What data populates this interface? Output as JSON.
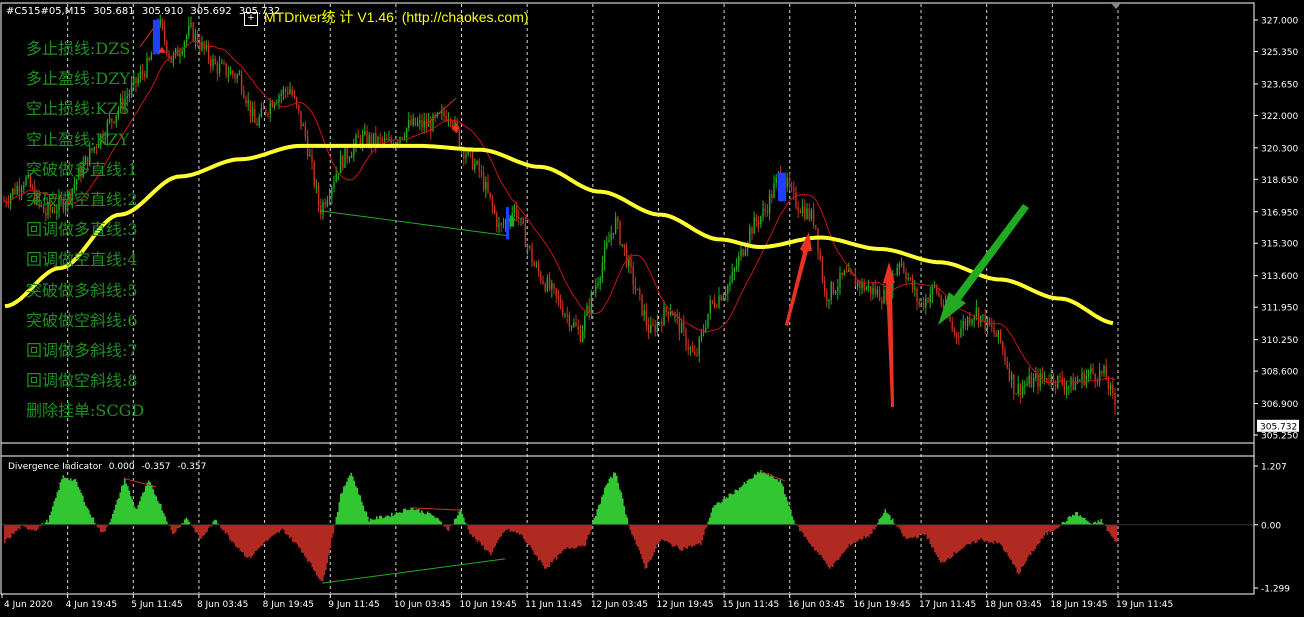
{
  "header": {
    "symbol_tf": "#C515#05,M15",
    "ohlc": [
      "305.681",
      "305.910",
      "305.692",
      "305.732"
    ]
  },
  "brand": {
    "title": "MTDriver统 计 V1.46",
    "url": "(http://chaokes.com)"
  },
  "commands": [
    "多止损线:DZS",
    "多止盈线:DZY",
    "空止损线:KZS",
    "空止盈线:KZY",
    "突破做多直线:1",
    "突破做空直线:2",
    "回调做多直线:3",
    "回调做空直线:4",
    "突破做多斜线:5",
    "突破做空斜线:6",
    "回调做多斜线:7",
    "回调做空斜线:8",
    "删除挂单:SCGD"
  ],
  "indicator": {
    "name": "Divergence Indicator",
    "values": [
      "0.000",
      "-0.357",
      "-0.357"
    ]
  },
  "colors": {
    "background": "#000000",
    "bull_candle": "#22b022",
    "bear_candle": "#c8321e",
    "ma_slow": "#ffff33",
    "ma_fast": "#c81414",
    "hist_pos": "#33c633",
    "hist_neg": "#b02a22",
    "arrow_red": "#e83222",
    "arrow_green": "#22aa22",
    "grid": "#ffffff",
    "price_tag_bg": "#ffffff"
  },
  "chart_data": [
    {
      "type": "line",
      "series": [],
      "ylim": [
        305.25,
        327.0
      ],
      "price_ticks": [
        "327.000",
        "325.350",
        "323.650",
        "322.000",
        "320.300",
        "318.650",
        "316.950",
        "315.300",
        "313.600",
        "311.950",
        "310.250",
        "308.600",
        "306.900",
        "305.250"
      ],
      "current_price": "305.732",
      "x_ticks": [
        "4 Jun 2020",
        "4 Jun 19:45",
        "5 Jun 11:45",
        "8 Jun 03:45",
        "8 Jun 19:45",
        "9 Jun 11:45",
        "10 Jun 03:45",
        "10 Jun 19:45",
        "11 Jun 11:45",
        "12 Jun 03:45",
        "12 Jun 19:45",
        "15 Jun 11:45",
        "16 Jun 03:45",
        "16 Jun 19:45",
        "17 Jun 11:45",
        "18 Jun 03:45",
        "18 Jun 19:45",
        "19 Jun 11:45"
      ],
      "grid": true
    },
    {
      "type": "bar",
      "ylim": [
        -1.299,
        1.207
      ],
      "value_ticks": [
        "1.207",
        "0.00",
        "-1.299"
      ],
      "grid": true
    }
  ]
}
